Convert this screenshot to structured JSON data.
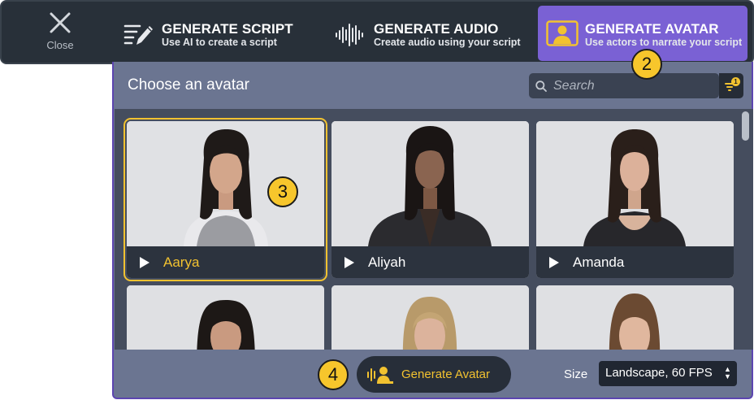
{
  "topbar": {
    "close_label": "Close",
    "tabs": [
      {
        "title": "GENERATE SCRIPT",
        "subtitle": "Use AI to create a script",
        "icon": "script-pencil-icon"
      },
      {
        "title": "GENERATE AUDIO",
        "subtitle": "Create audio using your script",
        "icon": "waveform-icon"
      },
      {
        "title": "GENERATE AVATAR",
        "subtitle": "Use actors to narrate your script",
        "icon": "avatar-icon",
        "active": true
      }
    ]
  },
  "panel": {
    "title": "Choose an avatar",
    "search_placeholder": "Search",
    "filter_badge": "1"
  },
  "avatars": [
    {
      "name": "Aarya",
      "selected": true
    },
    {
      "name": "Aliyah"
    },
    {
      "name": "Amanda"
    }
  ],
  "footer": {
    "generate_label": "Generate Avatar",
    "size_label": "Size",
    "size_value": "Landscape, 60 FPS"
  },
  "callouts": {
    "c2": "2",
    "c3": "3",
    "c4": "4"
  },
  "colors": {
    "accent": "#7a61d4",
    "highlight": "#f2c230",
    "panel": "#6b7591",
    "topbar": "#283039"
  }
}
